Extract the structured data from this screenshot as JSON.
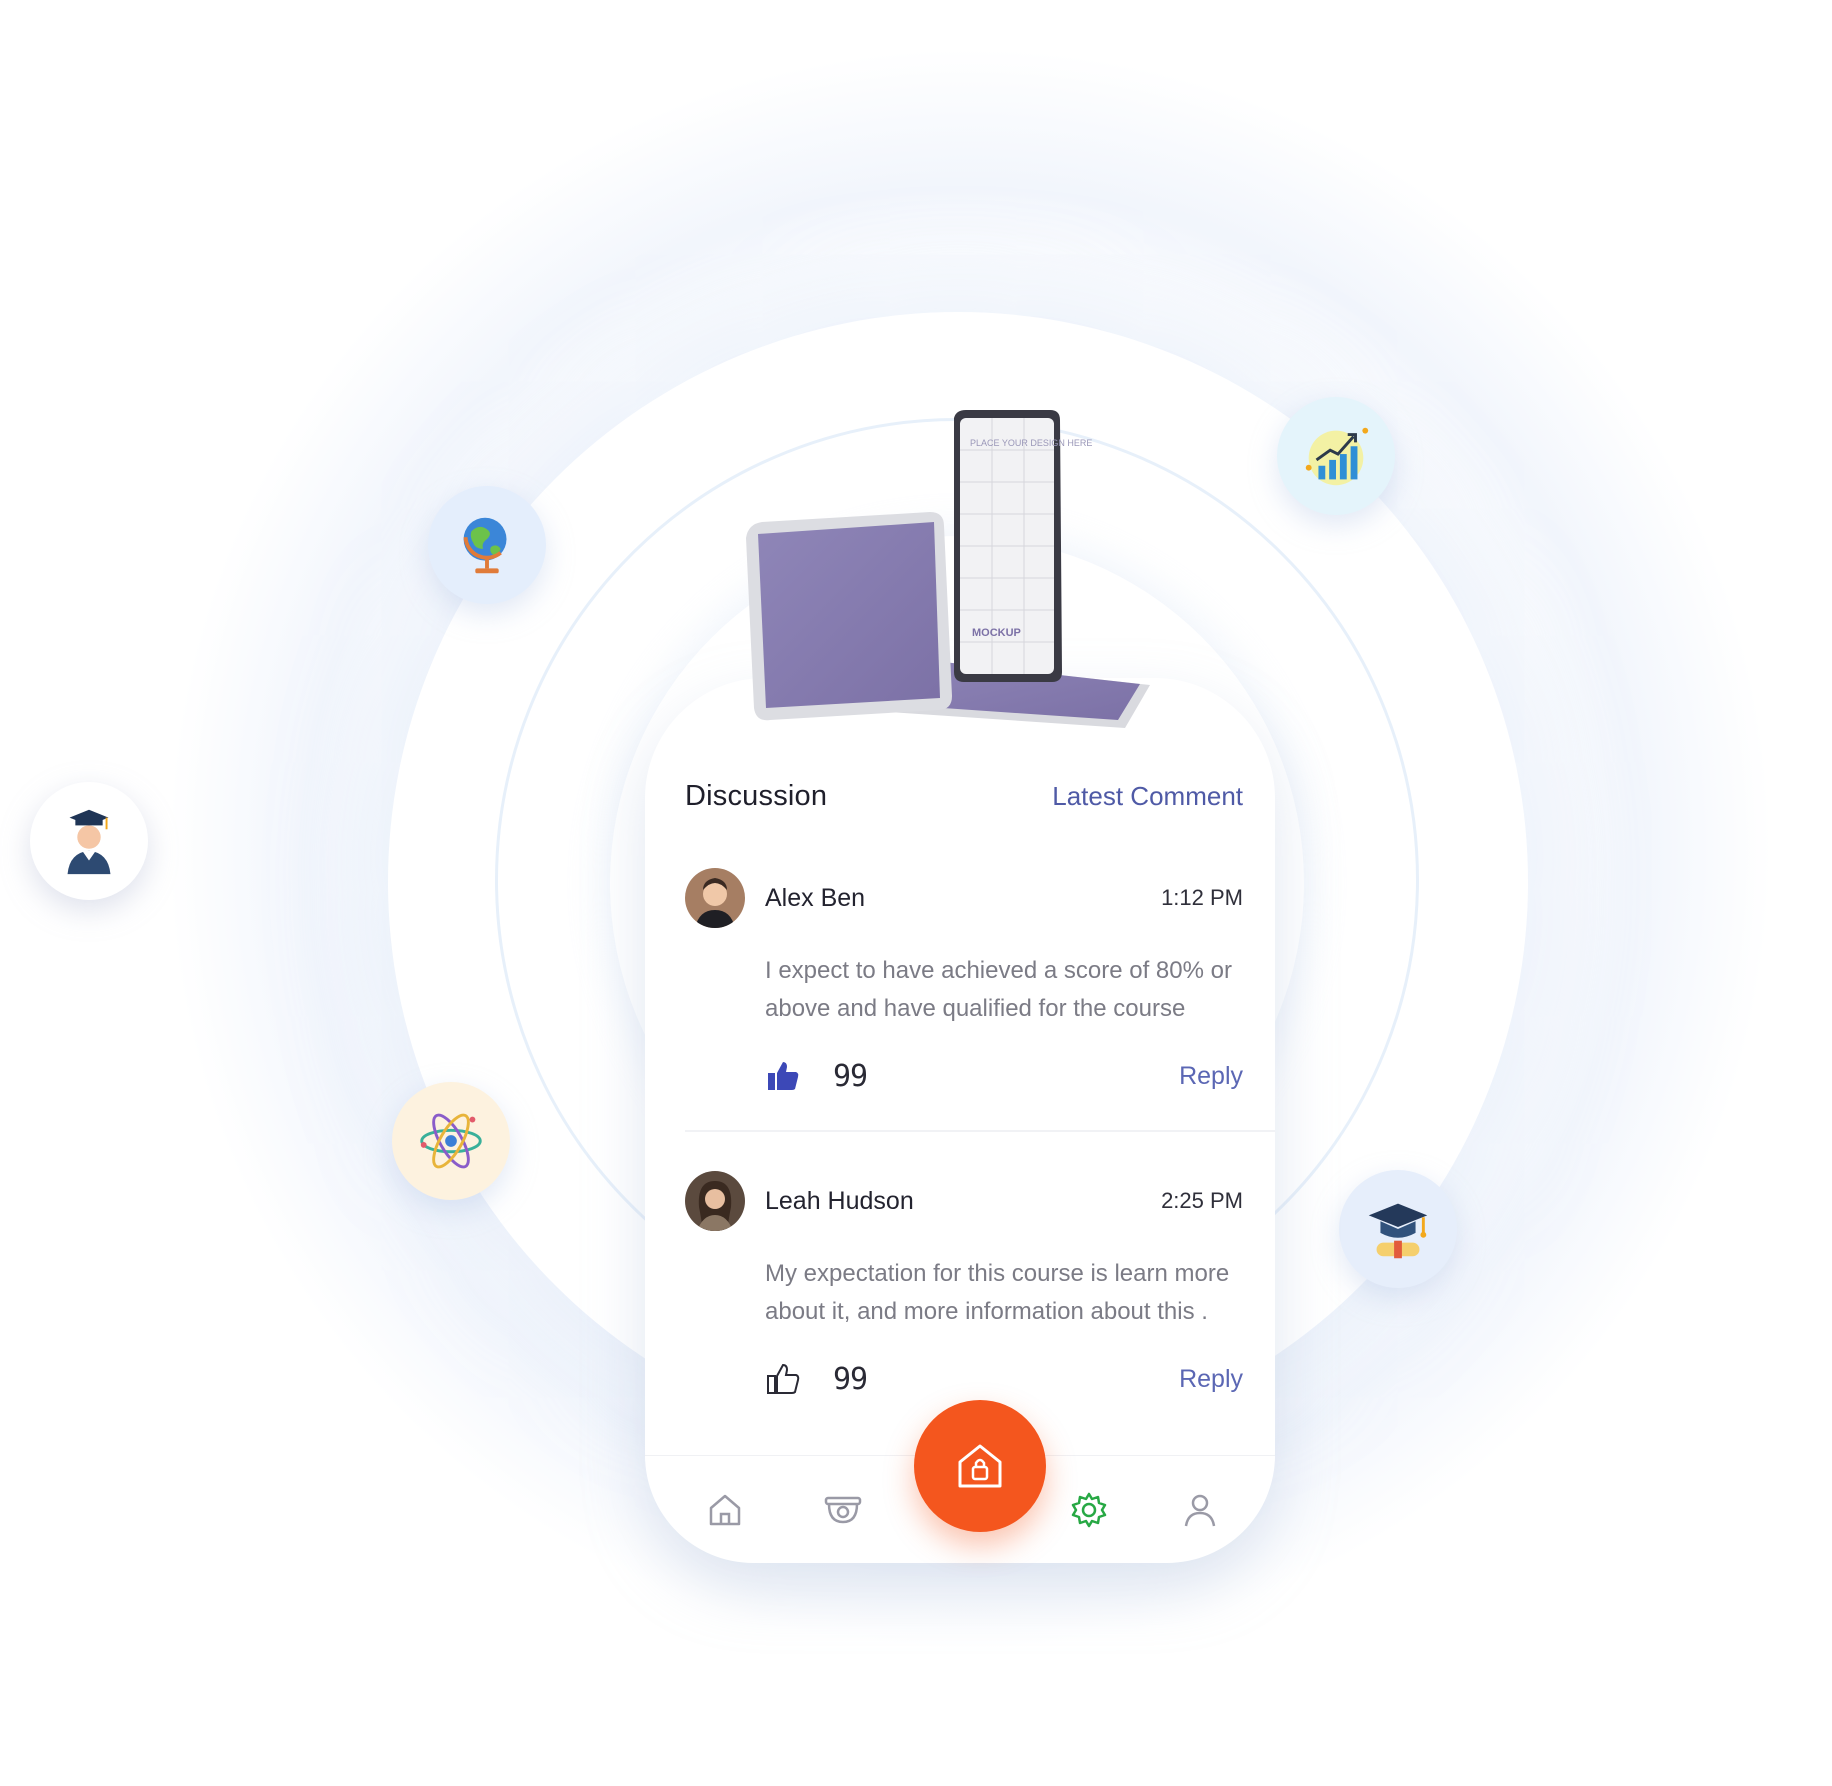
{
  "discussion": {
    "title": "Discussion",
    "latest_link": "Latest Comment"
  },
  "comments": [
    {
      "author": "Alex Ben",
      "time": "1:12 PM",
      "text": "I expect to have achieved a score of 80% or above and have qualified for the course",
      "count": "99",
      "reply": "Reply",
      "liked": true
    },
    {
      "author": "Leah Hudson",
      "time": "2:25 PM",
      "text": "My expectation for this course is learn more about it, and more information about this .",
      "count": "99",
      "reply": "Reply",
      "liked": false
    }
  ],
  "nav": {
    "items": [
      "home-icon",
      "camera-icon",
      "lock-home-icon",
      "settings-icon",
      "profile-icon"
    ],
    "active": "settings-icon"
  },
  "colors": {
    "accent": "#f4561e",
    "link": "#4f5aa6",
    "active_nav": "#27a844",
    "like": "#3c48b7"
  },
  "mockup": {
    "text": "PLACE YOUR DESIGN HERE",
    "label": "MOCKUP"
  }
}
